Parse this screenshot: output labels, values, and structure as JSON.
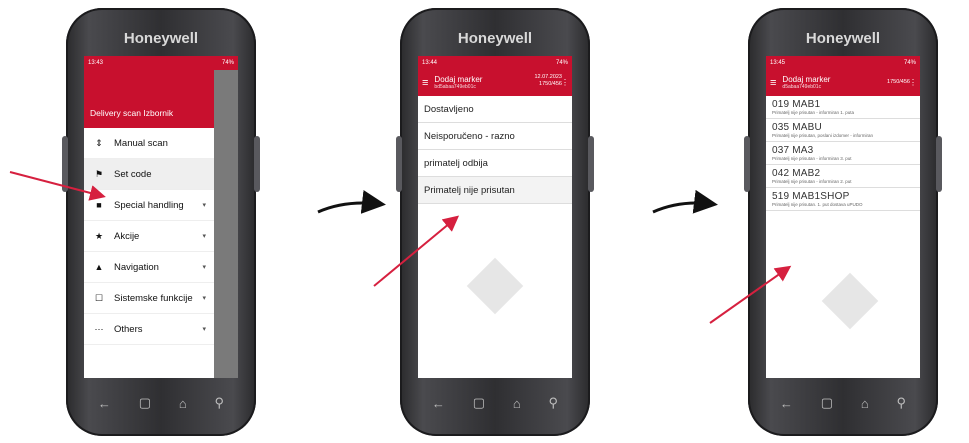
{
  "brand": "Honeywell",
  "phone1": {
    "status_time": "13:43",
    "status_right": "74%",
    "drawer_title": "Delivery scan Izbornik",
    "menu": [
      {
        "icon": "scan-icon",
        "glyph": "⇕",
        "label": "Manual scan",
        "chevron": false
      },
      {
        "icon": "flag-icon",
        "glyph": "⚑",
        "label": "Set code",
        "chevron": false
      },
      {
        "icon": "info-icon",
        "glyph": "■",
        "label": "Special handling",
        "chevron": true
      },
      {
        "icon": "star-icon",
        "glyph": "★",
        "label": "Akcije",
        "chevron": true
      },
      {
        "icon": "navigation-icon",
        "glyph": "▲",
        "label": "Navigation",
        "chevron": true
      },
      {
        "icon": "edit-icon",
        "glyph": "☐",
        "label": "Sistemske funkcije",
        "chevron": true
      },
      {
        "icon": "more-icon",
        "glyph": "⋯",
        "label": "Others",
        "chevron": true
      }
    ]
  },
  "phone2": {
    "status_time": "13:44",
    "status_right": "74%",
    "title": "Dodaj marker",
    "subtitle": "bd5abaa749eb01c",
    "date": "12.07.2023",
    "count": "1750/456",
    "options": [
      "Dostavljeno",
      "Neisporučeno - razno",
      "primatelj odbija",
      "Primatelj nije prisutan"
    ]
  },
  "phone3": {
    "status_time": "13:45",
    "status_right": "74%",
    "title": "Dodaj marker",
    "subtitle": "d5abaa749eb01c",
    "count": "1750/456",
    "items": [
      {
        "code": "019 MAB1",
        "desc": "Primatelj nije prisutan - informiran 1. puta"
      },
      {
        "code": "035 MABU",
        "desc": "Primatelj nije prisutan, poslani izdomer - informiran"
      },
      {
        "code": "037 MA3",
        "desc": "Primatelj nije prisutan - informiran 3. put"
      },
      {
        "code": "042 MAB2",
        "desc": "Primatelj nije prisutan - informiran 2. put"
      },
      {
        "code": "519 MAB1SHOP",
        "desc": "Primatelj nije prisutan. 1. put dostava uPUDO"
      }
    ]
  },
  "colors": {
    "accent": "#c8102e",
    "arrow": "#d6203f"
  }
}
